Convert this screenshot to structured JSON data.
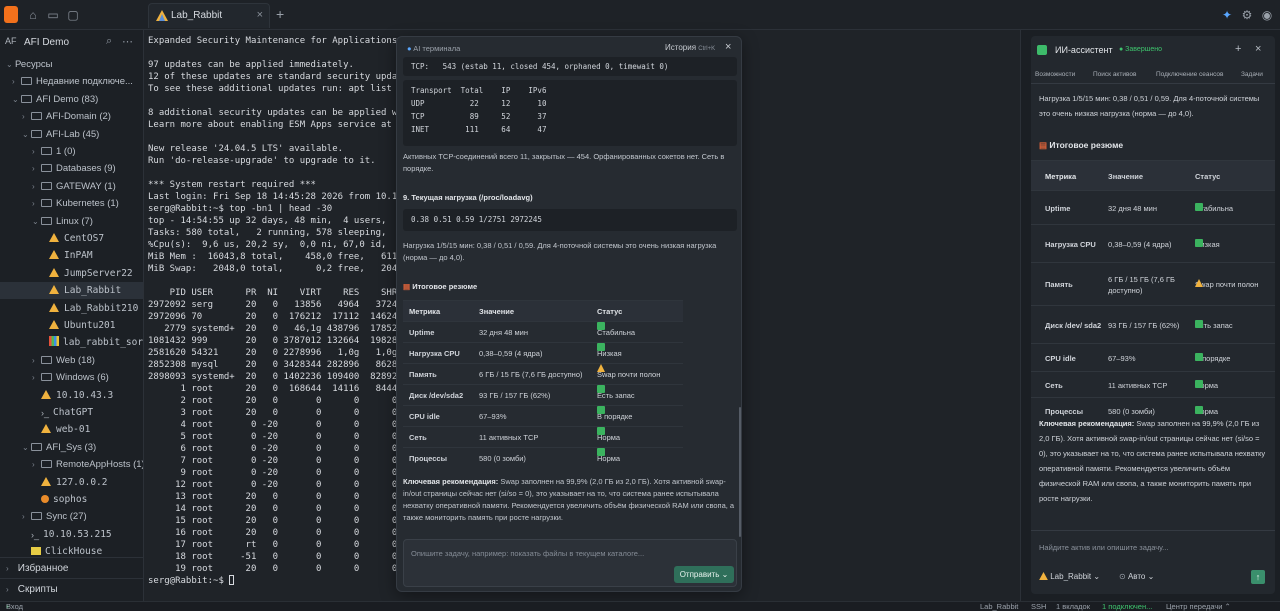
{
  "app": {
    "title": "Lab_Rabbit"
  },
  "tabs": [
    {
      "label": "Lab_Rabbit",
      "close": "×"
    }
  ],
  "tab_add": "+",
  "sidebar": {
    "workspace_badge": "AF",
    "workspace_name": "AFI Demo",
    "tree": [
      {
        "label": "Ресурсы",
        "chev": "⌄",
        "kind": "plain",
        "indent": 0
      },
      {
        "label": "Недавние подключе...",
        "chev": "›",
        "kind": "folder",
        "indent": 1
      },
      {
        "label": "AFI Demo (83)",
        "chev": "⌄",
        "kind": "folder",
        "indent": 1
      },
      {
        "label": "AFI-Domain (2)",
        "chev": "›",
        "kind": "folder",
        "indent": 2
      },
      {
        "label": "AFI-Lab (45)",
        "chev": "⌄",
        "kind": "folder",
        "indent": 2
      },
      {
        "label": "1 (0)",
        "chev": "›",
        "kind": "folder",
        "indent": 3
      },
      {
        "label": "Databases (9)",
        "chev": "›",
        "kind": "folder",
        "indent": 3
      },
      {
        "label": "GATEWAY (1)",
        "chev": "›",
        "kind": "folder",
        "indent": 3
      },
      {
        "label": "Kubernetes (1)",
        "chev": "›",
        "kind": "folder",
        "indent": 3
      },
      {
        "label": "Linux (7)",
        "chev": "⌄",
        "kind": "folder",
        "indent": 3
      },
      {
        "label": "CentOS7",
        "chev": "",
        "kind": "tri-y",
        "indent": 4,
        "mono": true
      },
      {
        "label": "InPAM",
        "chev": "",
        "kind": "tri-y",
        "indent": 4,
        "mono": true
      },
      {
        "label": "JumpServer22",
        "chev": "",
        "kind": "tri-y",
        "indent": 4,
        "mono": true
      },
      {
        "label": "Lab_Rabbit",
        "chev": "",
        "kind": "tri-y",
        "indent": 4,
        "mono": true,
        "selected": true
      },
      {
        "label": "Lab_Rabbit210",
        "chev": "",
        "kind": "tri-y",
        "indent": 4,
        "mono": true
      },
      {
        "label": "Ubuntu201",
        "chev": "",
        "kind": "tri-y",
        "indent": 4,
        "mono": true
      },
      {
        "label": "lab_rabbit_sorry",
        "chev": "",
        "kind": "mc",
        "indent": 4,
        "mono": true
      },
      {
        "label": "Web (18)",
        "chev": "›",
        "kind": "folder",
        "indent": 3
      },
      {
        "label": "Windows (6)",
        "chev": "›",
        "kind": "folder",
        "indent": 3
      },
      {
        "label": "10.10.43.3",
        "chev": "",
        "kind": "tri-y",
        "indent": 3,
        "mono": true
      },
      {
        "label": "ChatGPT",
        "chev": "",
        "kind": "pr",
        "indent": 3,
        "mono": true
      },
      {
        "label": "web-01",
        "chev": "",
        "kind": "tri-y",
        "indent": 3,
        "mono": true
      },
      {
        "label": "AFI_Sys (3)",
        "chev": "⌄",
        "kind": "folder",
        "indent": 2
      },
      {
        "label": "RemoteAppHosts (1)",
        "chev": "›",
        "kind": "folder",
        "indent": 3
      },
      {
        "label": "127.0.0.2",
        "chev": "",
        "kind": "tri-y",
        "indent": 3,
        "mono": true
      },
      {
        "label": "sophos",
        "chev": "",
        "kind": "dot",
        "indent": 3,
        "mono": true
      },
      {
        "label": "Sync (27)",
        "chev": "›",
        "kind": "folder",
        "indent": 2
      },
      {
        "label": "10.10.53.215",
        "chev": "",
        "kind": "pr",
        "indent": 2,
        "mono": true
      },
      {
        "label": "ClickHouse",
        "chev": "",
        "kind": "mon",
        "indent": 2,
        "mono": true
      }
    ],
    "favorites": "Избранное",
    "scripts": "Скрипты"
  },
  "terminal": {
    "lines": [
      "Expanded Security Maintenance for Applications is not",
      "",
      "97 updates can be applied immediately.",
      "12 of these updates are standard security updates.",
      "To see these additional updates run: apt list --upgra",
      "",
      "8 additional security updates can be applied with ESM",
      "Learn more about enabling ESM Apps service at https:/",
      "",
      "New release '24.04.5 LTS' available.",
      "Run 'do-release-upgrade' to upgrade to it.",
      "",
      "*** System restart required ***",
      "Last login: Fri Sep 18 14:45:28 2026 from 10.10.53.48",
      "serg@Rabbit:~$ top -bn1 | head -30",
      "top - 14:54:55 up 32 days, 48 min,  4 users,  load av",
      "Tasks: 580 total,   2 running, 578 sleeping,   0 stop",
      "%Cpu(s):  9,6 us, 20,2 sy,  0,0 ni, 67,0 id,  0,0 wa,",
      "MiB Mem :  16043,8 total,    458,0 free,   6113,2 use",
      "MiB Swap:   2048,0 total,      0,2 free,   2047,8 use",
      "",
      "    PID USER      PR  NI    VIRT    RES    SHR S  %CP",
      "2972092 serg      20   0   13856   4964   3724 R  20,",
      "2972096 70        20   0  176212  17112  14624 R  20,",
      "   2779 systemd+  20   0   46,1g 438796  17852 S  10,",
      "1081432 999       20   0 3787012 132664  19828 S  10,",
      "2581620 54321     20   0 2278996   1,0g   1,0g S   5,",
      "2852308 mysql     20   0 3428344 282896   8628 S   5,",
      "2898093 systemd+  20   0 1402236 109400  82892 S   5,",
      "      1 root      20   0  168644  14116   8444 S   0,",
      "      2 root      20   0       0      0      0 S   0,",
      "      3 root      20   0       0      0      0 S   0,",
      "      4 root       0 -20       0      0      0 I   0,",
      "      5 root       0 -20       0      0      0 I   0,",
      "      6 root       0 -20       0      0      0 I   0,",
      "      7 root       0 -20       0      0      0 I   0,",
      "      9 root       0 -20       0      0      0 I   0,",
      "     12 root       0 -20       0      0      0 I   0,",
      "     13 root      20   0       0      0      0 I   0,",
      "     14 root      20   0       0      0      0 I   0,",
      "     15 root      20   0       0      0      0 S   0,",
      "     16 root      20   0       0      0      0 I   0,",
      "     17 root      rt   0       0      0      0 S   0,",
      "     18 root     -51   0       0      0      0 S   0,",
      "     19 root      20   0       0      0      0 S   0,"
    ],
    "prompt": "serg@Rabbit:~$ "
  },
  "ai_popup": {
    "title": "AI терминала",
    "history": "История",
    "history_hotkey": "Ctrl+K",
    "close": "×",
    "netstat_header": "TCP:   543 (estab 11, closed 454, orphaned 0, timewait 0)",
    "netstat_table": [
      "Transport  Total    IP    IPv6",
      "UDP          22     12      10",
      "TCP          89     52      37",
      "INET        111     64      47"
    ],
    "tcp_summary": "Активных TCP-соединений всего 11, закрытых — 454. Орфанированных сокетов нет. Сеть в порядке.",
    "load_heading": "9. Текущая нагрузка (/proc/loadavg)",
    "loadavg": "0.38 0.51 0.59 1/2751 2972245",
    "load_text": "Нагрузка 1/5/15 мин: 0,38 / 0,51 / 0,59. Для 4-поточной системы это очень низкая нагрузка (норма — до 4,0).",
    "summary_heading": "Итоговое резюме",
    "table_headers": [
      "Метрика",
      "Значение",
      "Статус"
    ],
    "table_rows": [
      {
        "metric": "Uptime",
        "value": "32 дня 48 мин",
        "status": "Стабильна",
        "level": "ok"
      },
      {
        "metric": "Нагрузка CPU",
        "value": "0,38–0,59 (4 ядра)",
        "status": "Низкая",
        "level": "ok"
      },
      {
        "metric": "Память",
        "value": "6 ГБ / 15 ГБ (7,6 ГБ доступно)",
        "status": "Swap почти полон",
        "level": "warn"
      },
      {
        "metric": "Диск /dev/sda2",
        "value": "93 ГБ / 157 ГБ (62%)",
        "status": "Есть запас",
        "level": "ok"
      },
      {
        "metric": "CPU idle",
        "value": "67–93%",
        "status": "В порядке",
        "level": "ok"
      },
      {
        "metric": "Сеть",
        "value": "11 активных TCP",
        "status": "Норма",
        "level": "ok"
      },
      {
        "metric": "Процессы",
        "value": "580 (0 зомби)",
        "status": "Норма",
        "level": "ok"
      }
    ],
    "recommendation_label": "Ключевая рекомендация:",
    "recommendation": "Swap заполнен на 99,9% (2,0 ГБ из 2,0 ГБ). Хотя активной swap-in/out страницы сейчас нет (si/so = 0), это указывает на то, что система ранее испытывала нехватку оперативной памяти. Рекомендуется увеличить объём физической RAM или свопа, а также мониторить память при росте нагрузки.",
    "input_placeholder": "Опишите задачу, например: показать файлы в текущем каталоге...",
    "send": "Отправить ⌄"
  },
  "assistant": {
    "title": "ИИ-ассистент",
    "status": "● Завершено",
    "add": "+",
    "close": "×",
    "tabs": [
      "Возможности",
      "Поиск активов",
      "Подключение сеансов",
      "Задачи"
    ],
    "top_text": "Нагрузка 1/5/15 мин: 0,38 / 0,51 / 0,59. Для 4-поточной системы это очень низкая нагрузка (норма — до 4,0).",
    "summary_heading": "Итоговое резюме",
    "table_headers": [
      "Метрика",
      "Значение",
      "Статус"
    ],
    "table_rows": [
      {
        "metric": "Uptime",
        "value": "32 дня 48 мин",
        "status": "Стабильна",
        "level": "ok"
      },
      {
        "metric": "Нагрузка CPU",
        "value": "0,38–0,59 (4 ядра)",
        "status": "Низкая",
        "level": "ok"
      },
      {
        "metric": "Память",
        "value": "6 ГБ / 15 ГБ (7,6 ГБ доступно)",
        "status": "Swap почти полон",
        "level": "warn"
      },
      {
        "metric": "Диск /dev/ sda2",
        "value": "93 ГБ / 157 ГБ (62%)",
        "status": "Есть запас",
        "level": "ok"
      },
      {
        "metric": "CPU idle",
        "value": "67–93%",
        "status": "В порядке",
        "level": "ok"
      },
      {
        "metric": "Сеть",
        "value": "11 активных TCP",
        "status": "Норма",
        "level": "ok"
      },
      {
        "metric": "Процессы",
        "value": "580 (0 зомби)",
        "status": "Норма",
        "level": "ok"
      }
    ],
    "recommendation_label": "Ключевая рекомендация:",
    "recommendation": "Swap заполнен на 99,9% (2,0 ГБ из 2,0 ГБ). Хотя активной swap-in/out страницы сейчас нет (si/so = 0), это указывает на то, что система ранее испытывала нехватку оперативной памяти. Рекомендуется увеличить объём физической RAM или свопа, а также мониторить память при росте нагрузки.",
    "input_placeholder": "Найдите актив или опишите задачу...",
    "asset_chip": "Lab_Rabbit ⌄",
    "mode_chip": "Авто ⌄",
    "send": "↑"
  },
  "statusbar": {
    "login": "Вход выполнен: Administrator",
    "host": "Lab_Rabbit",
    "protocol": "SSH",
    "tabs_count": "1 вкладок",
    "connections": "1 подключен...",
    "transfer": "Центр передачи ⌃"
  },
  "colors": {
    "accent": "#3ec46d",
    "brand": "#f2711c",
    "warn": "#f0b23e"
  }
}
